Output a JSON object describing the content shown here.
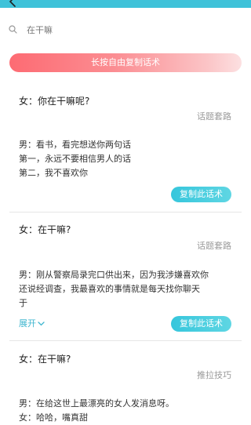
{
  "header": {
    "icon": "back-arrow-icon"
  },
  "search": {
    "placeholder": "在干嘛",
    "icon": "search-icon"
  },
  "banner": {
    "label": "长按自由复制话术"
  },
  "cards": [
    {
      "question": "女：你在干嘛呢?",
      "category": "话题套路",
      "answer_lines": [
        "男：看书，看完想送你两句话",
        "第一，永远不要相信男人的话",
        "第二，我不喜欢你"
      ],
      "copy_label": "复制此话术"
    },
    {
      "question": "女：在干嘛?",
      "category": "话题套路",
      "answer_lines": [
        "男：刚从警察局录完口供出来，因为我涉嫌喜欢你",
        "还说经调查，我最喜欢的事情就是每天找你聊天",
        "于"
      ],
      "expand_label": "展开",
      "copy_label": "复制此话术"
    },
    {
      "question": "女：在干嘛?",
      "category": "推拉技巧",
      "answer_lines": [
        "男：在给这世上最漂亮的女人发消息呀。",
        "女：哈哈，嘴真甜"
      ]
    }
  ],
  "colors": {
    "accent": "#3fc2d9",
    "banner_start": "#fd6b73",
    "expand": "#3fb6cf"
  }
}
